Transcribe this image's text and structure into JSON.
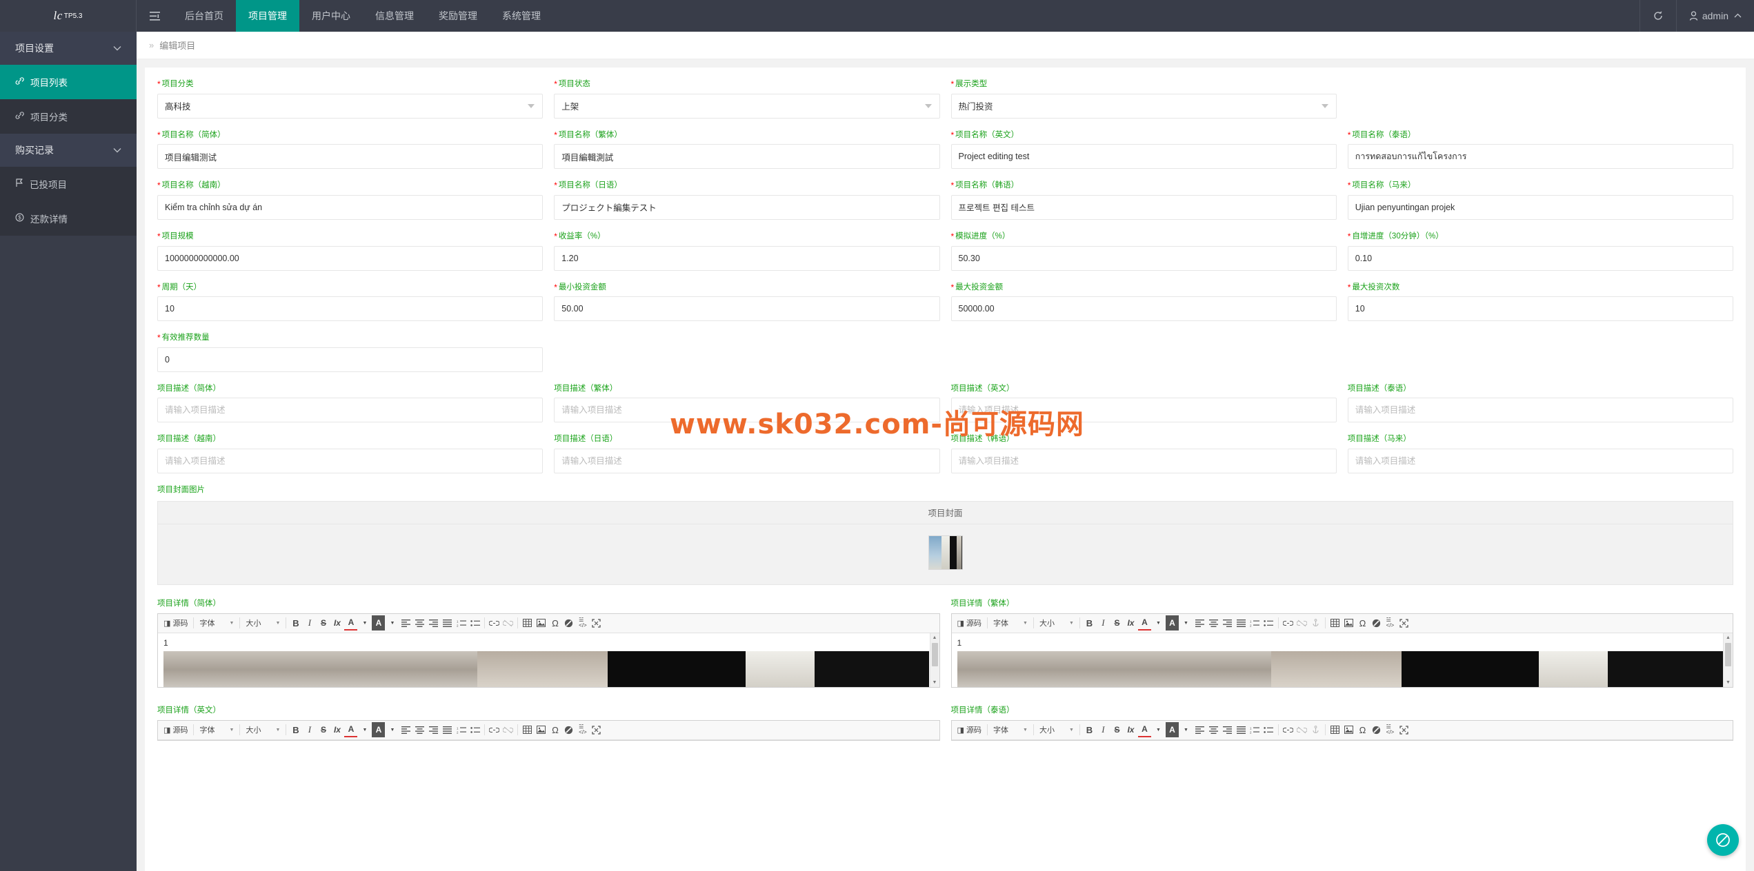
{
  "topbar": {
    "logo": "lc",
    "logo_sup": "TP5.3",
    "hamburger_icon": "menu-icon",
    "nav": [
      {
        "label": "后台首页",
        "active": false
      },
      {
        "label": "项目管理",
        "active": true
      },
      {
        "label": "用户中心",
        "active": false
      },
      {
        "label": "信息管理",
        "active": false
      },
      {
        "label": "奖励管理",
        "active": false
      },
      {
        "label": "系统管理",
        "active": false
      }
    ],
    "refresh_icon": "↻",
    "user_icon": "⚲",
    "user_name": "admin",
    "user_caret": "⌃"
  },
  "sidebar": {
    "groups": [
      {
        "label": "项目设置",
        "chev": "⌄",
        "items": [
          {
            "label": "项目列表",
            "icon": "link-icon",
            "glyph": "🔗",
            "active": true
          },
          {
            "label": "项目分类",
            "icon": "link-icon",
            "glyph": "🔗",
            "active": false
          }
        ]
      },
      {
        "label": "购买记录",
        "chev": "⌄",
        "items": [
          {
            "label": "已投项目",
            "icon": "flag-icon",
            "glyph": "⚑",
            "active": false
          },
          {
            "label": "还款详情",
            "icon": "dollar-icon",
            "glyph": "Ⓢ",
            "active": false
          }
        ]
      }
    ]
  },
  "breadcrumb": {
    "sep": "»",
    "current": "编辑项目"
  },
  "form": {
    "row1": [
      {
        "label": "项目分类",
        "required": true,
        "type": "select",
        "value": "高科技"
      },
      {
        "label": "项目状态",
        "required": true,
        "type": "select",
        "value": "上架"
      },
      {
        "label": "展示类型",
        "required": true,
        "type": "select",
        "value": "热门投资"
      }
    ],
    "row2": [
      {
        "label": "项目名称（简体）",
        "required": true,
        "value": "项目编辑测试"
      },
      {
        "label": "项目名称（繁体）",
        "required": true,
        "value": "項目編輯測試"
      },
      {
        "label": "项目名称（英文）",
        "required": true,
        "value": "Project editing test"
      },
      {
        "label": "项目名称（泰语）",
        "required": true,
        "value": "การทดสอบการแก้ไขโครงการ"
      }
    ],
    "row3": [
      {
        "label": "项目名称（越南）",
        "required": true,
        "value": "Kiểm tra chỉnh sửa dự án"
      },
      {
        "label": "项目名称（日语）",
        "required": true,
        "value": "プロジェクト編集テスト"
      },
      {
        "label": "项目名称（韩语）",
        "required": true,
        "value": "프로젝트 편집 테스트"
      },
      {
        "label": "项目名称（马来）",
        "required": true,
        "value": "Ujian penyuntingan projek"
      }
    ],
    "row4": [
      {
        "label": "项目规模",
        "required": true,
        "value": "1000000000000.00"
      },
      {
        "label": "收益率（%）",
        "required": true,
        "value": "1.20"
      },
      {
        "label": "模拟进度（%）",
        "required": true,
        "value": "50.30"
      },
      {
        "label": "自增进度（30分钟）（%）",
        "required": true,
        "value": "0.10"
      }
    ],
    "row5": [
      {
        "label": "周期（天）",
        "required": true,
        "value": "10"
      },
      {
        "label": "最小投资金额",
        "required": true,
        "value": "50.00"
      },
      {
        "label": "最大投资金额",
        "required": true,
        "value": "50000.00"
      },
      {
        "label": "最大投资次数",
        "required": true,
        "value": "10"
      }
    ],
    "row6": [
      {
        "label": "有效推荐数量",
        "required": true,
        "value": "0"
      }
    ],
    "desc_placeholder": "请输入项目描述",
    "row7": [
      {
        "label": "项目描述（简体）",
        "required": false,
        "value": ""
      },
      {
        "label": "项目描述（繁体）",
        "required": false,
        "value": ""
      },
      {
        "label": "项目描述（英文）",
        "required": false,
        "value": ""
      },
      {
        "label": "项目描述（泰语）",
        "required": false,
        "value": ""
      }
    ],
    "row8": [
      {
        "label": "项目描述（越南）",
        "required": false,
        "value": ""
      },
      {
        "label": "项目描述（日语）",
        "required": false,
        "value": ""
      },
      {
        "label": "项目描述（韩语）",
        "required": false,
        "value": ""
      },
      {
        "label": "项目描述（马来）",
        "required": false,
        "value": ""
      }
    ]
  },
  "cover": {
    "label": "项目封面图片",
    "table_header": "项目封面"
  },
  "editors": {
    "toolbar": {
      "source_label": "源码",
      "font_label": "字体",
      "size_label": "大小",
      "bold": "B",
      "italic": "I",
      "strike": "S",
      "remove_format": "Ix",
      "text_color": "A",
      "bg_color": "A",
      "align_left": "≡",
      "align_center": "≡",
      "align_right": "≡",
      "justify": "≡",
      "ordered_list": "⒈≡",
      "unordered_list": "⁞≡",
      "link": "🔗",
      "unlink": "🔗",
      "table": "⊞",
      "image": "🖼",
      "omega": "Ω",
      "clear": "◑",
      "div": "⁇",
      "maximize": "⤢"
    },
    "content_line": "1",
    "panels": [
      {
        "label": "项目详情（简体）"
      },
      {
        "label": "项目详情（繁体）"
      },
      {
        "label": "项目详情（英文）"
      },
      {
        "label": "项目详情（泰语）"
      }
    ]
  },
  "watermark": "www.sk032.com-尚可源码网",
  "float_button": {
    "icon": "no-entry-icon",
    "glyph": "🚫"
  },
  "colors": {
    "accent": "#009688",
    "dark": "#393D49",
    "label_green": "#1aa11a",
    "required_red": "#ff0000",
    "watermark": "#ED6A2C"
  }
}
